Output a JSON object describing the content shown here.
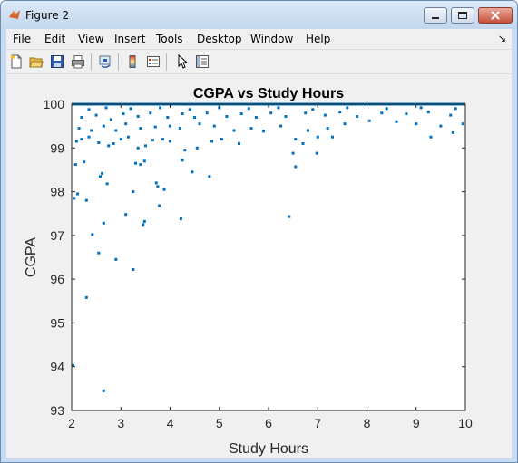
{
  "window": {
    "title": "Figure 2"
  },
  "menu": [
    "File",
    "Edit",
    "View",
    "Insert",
    "Tools",
    "Desktop",
    "Window",
    "Help"
  ],
  "menu_arrow": "↘",
  "toolbar_icons": [
    "new-figure-icon",
    "open-file-icon",
    "save-icon",
    "print-icon",
    "link-icon",
    "colorbar-icon",
    "legend-icon",
    "pointer-icon",
    "property-editor-icon"
  ],
  "colors": {
    "marker": "#0072bd",
    "axes_bg": "#ffffff",
    "figure_bg": "#f0f0f0"
  },
  "chart_data": {
    "type": "scatter",
    "title": "CGPA vs Study Hours",
    "xlabel": "Study Hours",
    "ylabel": "CGPA",
    "xlim": [
      2,
      10
    ],
    "ylim": [
      93,
      100
    ],
    "xticks": [
      2,
      3,
      4,
      5,
      6,
      7,
      8,
      9,
      10
    ],
    "yticks": [
      93,
      94,
      95,
      96,
      97,
      98,
      99,
      100
    ],
    "grid": false,
    "points": [
      [
        2.03,
        94.03
      ],
      [
        2.65,
        93.45
      ],
      [
        2.3,
        95.58
      ],
      [
        2.55,
        96.6
      ],
      [
        2.9,
        96.45
      ],
      [
        3.25,
        96.22
      ],
      [
        2.42,
        97.02
      ],
      [
        2.65,
        97.28
      ],
      [
        3.45,
        97.25
      ],
      [
        3.48,
        97.32
      ],
      [
        3.1,
        97.48
      ],
      [
        4.22,
        97.38
      ],
      [
        6.42,
        97.43
      ],
      [
        2.05,
        97.85
      ],
      [
        2.12,
        97.95
      ],
      [
        2.3,
        97.8
      ],
      [
        2.72,
        98.18
      ],
      [
        3.25,
        98.0
      ],
      [
        3.72,
        98.2
      ],
      [
        3.75,
        98.12
      ],
      [
        3.88,
        98.05
      ],
      [
        3.78,
        97.68
      ],
      [
        4.8,
        98.35
      ],
      [
        4.45,
        98.45
      ],
      [
        2.62,
        98.42
      ],
      [
        2.58,
        98.35
      ],
      [
        2.08,
        98.62
      ],
      [
        2.25,
        98.68
      ],
      [
        3.3,
        98.65
      ],
      [
        3.4,
        98.62
      ],
      [
        3.48,
        98.7
      ],
      [
        4.25,
        98.72
      ],
      [
        6.55,
        98.57
      ],
      [
        6.98,
        98.88
      ],
      [
        6.5,
        98.88
      ],
      [
        2.1,
        99.15
      ],
      [
        2.2,
        99.2
      ],
      [
        2.35,
        99.25
      ],
      [
        2.55,
        99.12
      ],
      [
        2.75,
        99.05
      ],
      [
        2.85,
        99.1
      ],
      [
        3.0,
        99.2
      ],
      [
        3.15,
        99.25
      ],
      [
        3.35,
        99.0
      ],
      [
        3.5,
        99.05
      ],
      [
        3.65,
        99.18
      ],
      [
        3.85,
        99.2
      ],
      [
        4.0,
        99.15
      ],
      [
        4.3,
        98.95
      ],
      [
        4.55,
        99.0
      ],
      [
        4.85,
        99.15
      ],
      [
        5.05,
        99.2
      ],
      [
        5.4,
        99.1
      ],
      [
        6.55,
        99.2
      ],
      [
        6.7,
        99.1
      ],
      [
        7.0,
        99.25
      ],
      [
        7.3,
        99.25
      ],
      [
        9.3,
        99.25
      ],
      [
        9.75,
        99.35
      ],
      [
        2.15,
        99.45
      ],
      [
        2.4,
        99.4
      ],
      [
        2.65,
        99.5
      ],
      [
        2.9,
        99.4
      ],
      [
        3.1,
        99.55
      ],
      [
        3.4,
        99.45
      ],
      [
        3.7,
        99.48
      ],
      [
        4.0,
        99.5
      ],
      [
        4.2,
        99.45
      ],
      [
        4.6,
        99.55
      ],
      [
        4.9,
        99.5
      ],
      [
        5.3,
        99.4
      ],
      [
        5.65,
        99.45
      ],
      [
        5.9,
        99.38
      ],
      [
        6.25,
        99.5
      ],
      [
        6.8,
        99.4
      ],
      [
        7.2,
        99.45
      ],
      [
        7.55,
        99.55
      ],
      [
        8.05,
        99.62
      ],
      [
        8.6,
        99.6
      ],
      [
        9.0,
        99.55
      ],
      [
        9.5,
        99.5
      ],
      [
        9.95,
        99.55
      ],
      [
        2.2,
        99.7
      ],
      [
        2.5,
        99.75
      ],
      [
        2.8,
        99.65
      ],
      [
        3.05,
        99.78
      ],
      [
        3.35,
        99.72
      ],
      [
        3.6,
        99.8
      ],
      [
        3.95,
        99.7
      ],
      [
        4.25,
        99.78
      ],
      [
        4.5,
        99.7
      ],
      [
        4.75,
        99.8
      ],
      [
        5.15,
        99.72
      ],
      [
        5.45,
        99.78
      ],
      [
        5.75,
        99.7
      ],
      [
        6.05,
        99.8
      ],
      [
        6.35,
        99.72
      ],
      [
        6.75,
        99.8
      ],
      [
        7.15,
        99.75
      ],
      [
        7.45,
        99.82
      ],
      [
        7.8,
        99.72
      ],
      [
        8.3,
        99.8
      ],
      [
        8.8,
        99.78
      ],
      [
        9.25,
        99.82
      ],
      [
        9.7,
        99.75
      ],
      [
        2.35,
        99.88
      ],
      [
        2.7,
        99.92
      ],
      [
        3.2,
        99.9
      ],
      [
        3.8,
        99.92
      ],
      [
        4.4,
        99.88
      ],
      [
        5.0,
        99.92
      ],
      [
        5.6,
        99.9
      ],
      [
        6.2,
        99.92
      ],
      [
        6.9,
        99.88
      ],
      [
        7.6,
        99.92
      ],
      [
        8.4,
        99.9
      ],
      [
        9.1,
        99.92
      ],
      [
        9.8,
        99.9
      ],
      [
        2.1,
        100.0
      ],
      [
        2.3,
        100.0
      ],
      [
        2.5,
        100.0
      ],
      [
        2.7,
        100.0
      ],
      [
        2.9,
        100.0
      ],
      [
        3.1,
        100.0
      ],
      [
        3.3,
        100.0
      ],
      [
        3.5,
        100.0
      ],
      [
        3.7,
        100.0
      ],
      [
        3.9,
        100.0
      ],
      [
        4.1,
        100.0
      ],
      [
        4.3,
        100.0
      ],
      [
        4.5,
        100.0
      ],
      [
        4.7,
        100.0
      ],
      [
        4.9,
        100.0
      ],
      [
        5.1,
        100.0
      ],
      [
        5.3,
        100.0
      ],
      [
        5.5,
        100.0
      ],
      [
        5.7,
        100.0
      ],
      [
        5.9,
        100.0
      ],
      [
        6.1,
        100.0
      ],
      [
        6.3,
        100.0
      ],
      [
        6.5,
        100.0
      ],
      [
        6.7,
        100.0
      ],
      [
        6.9,
        100.0
      ],
      [
        7.1,
        100.0
      ],
      [
        7.3,
        100.0
      ],
      [
        7.5,
        100.0
      ],
      [
        7.7,
        100.0
      ],
      [
        7.9,
        100.0
      ],
      [
        8.1,
        100.0
      ],
      [
        8.3,
        100.0
      ],
      [
        8.5,
        100.0
      ],
      [
        8.7,
        100.0
      ],
      [
        8.9,
        100.0
      ],
      [
        9.1,
        100.0
      ],
      [
        9.3,
        100.0
      ],
      [
        9.5,
        100.0
      ],
      [
        9.7,
        100.0
      ],
      [
        9.9,
        100.0
      ]
    ]
  }
}
